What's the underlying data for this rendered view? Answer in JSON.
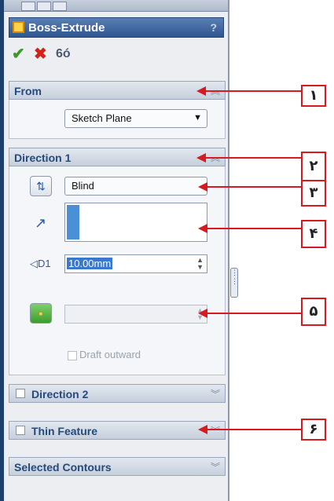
{
  "panel": {
    "title": "Boss-Extrude",
    "help": "?",
    "accent": "#2f5690"
  },
  "actions": {
    "ok": "✔",
    "cancel": "✖",
    "preview": "6ó"
  },
  "from": {
    "label": "From",
    "start_condition": "Sketch Plane"
  },
  "direction1": {
    "label": "Direction 1",
    "end_condition": "Blind",
    "depth": "10.00mm",
    "draft_label": "Draft outward"
  },
  "direction2": {
    "label": "Direction 2"
  },
  "thin_feature": {
    "label": "Thin Feature"
  },
  "selected_contours": {
    "label": "Selected Contours"
  },
  "callouts": [
    "۱",
    "۲",
    "۳",
    "۴",
    "۵",
    "۶"
  ],
  "colors": {
    "callout": "#d71921",
    "ok": "#3a9a2a",
    "cancel": "#d2231b"
  }
}
